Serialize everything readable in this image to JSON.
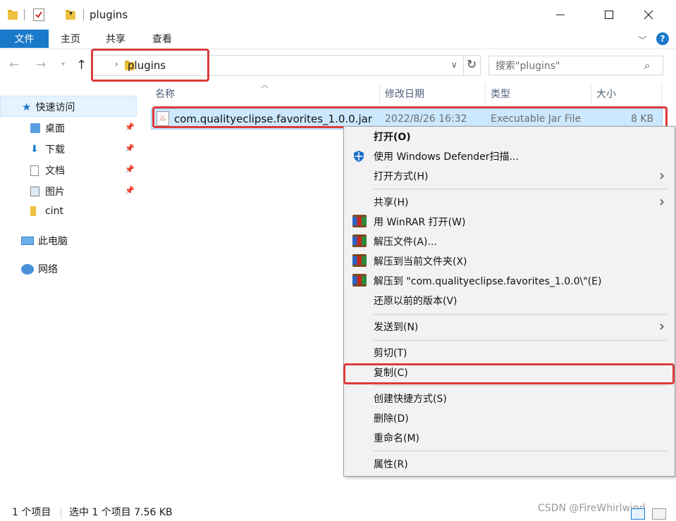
{
  "window": {
    "title": "plugins"
  },
  "ribbon": {
    "file": "文件",
    "tabs": [
      "主页",
      "共享",
      "查看"
    ],
    "help": "?"
  },
  "address": {
    "crumb": "plugins"
  },
  "search": {
    "placeholder": "搜索\"plugins\""
  },
  "nav": {
    "quick_access": "快速访问",
    "items": [
      {
        "label": "桌面",
        "pinned": true
      },
      {
        "label": "下载",
        "pinned": true
      },
      {
        "label": "文档",
        "pinned": true
      },
      {
        "label": "图片",
        "pinned": true
      },
      {
        "label": "cint",
        "pinned": false
      }
    ],
    "this_pc": "此电脑",
    "network": "网络"
  },
  "columns": {
    "name": "名称",
    "modified": "修改日期",
    "type": "类型",
    "size": "大小"
  },
  "file": {
    "name": "com.qualityeclipse.favorites_1.0.0.jar",
    "modified": "2022/8/26 16:32",
    "type": "Executable Jar File",
    "size": "8 KB"
  },
  "context_menu": {
    "open": "打开(O)",
    "defender": "使用 Windows Defender扫描...",
    "open_with": "打开方式(H)",
    "share": "共享(H)",
    "winrar_open": "用 WinRAR 打开(W)",
    "extract": "解压文件(A)...",
    "extract_here": "解压到当前文件夹(X)",
    "extract_to": "解压到 \"com.qualityeclipse.favorites_1.0.0\\\"(E)",
    "restore": "还原以前的版本(V)",
    "send_to": "发送到(N)",
    "cut": "剪切(T)",
    "copy": "复制(C)",
    "shortcut": "创建快捷方式(S)",
    "delete": "删除(D)",
    "rename": "重命名(M)",
    "properties": "属性(R)"
  },
  "status": {
    "count": "1 个项目",
    "selected": "选中 1 个项目  7.56 KB"
  },
  "watermark": "CSDN @FireWhirlwind",
  "colors": {
    "accent": "#1979ca",
    "highlight_box": "#dd3b3b",
    "selection": "#cce8ff"
  }
}
